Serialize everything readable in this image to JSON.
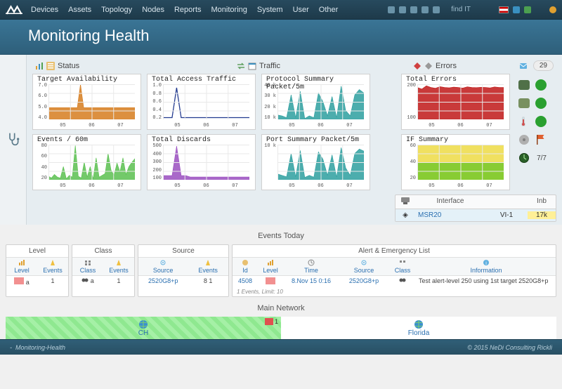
{
  "nav": {
    "links": [
      "Devices",
      "Assets",
      "Topology",
      "Nodes",
      "Reports",
      "Monitoring",
      "System",
      "User",
      "Other"
    ],
    "search": "find IT"
  },
  "title": "Monitoring Health",
  "sections": {
    "status": "Status",
    "traffic": "Traffic",
    "errors": "Errors",
    "errors_badge": "29"
  },
  "charts": {
    "c1": {
      "title": "Target Availability",
      "y": [
        "7.0",
        "6.0",
        "5.0",
        "4.0"
      ],
      "x": [
        "05",
        "06",
        "07"
      ]
    },
    "c2": {
      "title": "Events / 60m",
      "y": [
        "80",
        "60",
        "40",
        "20"
      ],
      "x": [
        "05",
        "06",
        "07"
      ]
    },
    "c3": {
      "title": "Total Access Traffic",
      "y": [
        "1.0",
        "0.8",
        "0.6",
        "0.4",
        "0.2"
      ],
      "x": [
        "05",
        "06",
        "07"
      ]
    },
    "c4": {
      "title": "Total Discards",
      "y": [
        "500",
        "400",
        "300",
        "200",
        "100"
      ],
      "x": [
        "05",
        "06",
        "07"
      ]
    },
    "c5": {
      "title": "Protocol Summary Packet/5m",
      "y": [
        "40 k",
        "30 k",
        "20 k",
        "10 k"
      ],
      "x": [
        "05",
        "06",
        "07"
      ]
    },
    "c6": {
      "title": "Port Summary  Packet/5m",
      "y": [
        "10 k"
      ],
      "x": [
        "05",
        "06",
        "07"
      ]
    },
    "c7": {
      "title": "Total Errors",
      "y": [
        "200",
        "100"
      ],
      "x": [
        "05",
        "06",
        "07"
      ]
    },
    "c8": {
      "title": "IF Summary",
      "y": [
        "60",
        "40",
        "20"
      ],
      "x": [
        "05",
        "06",
        "07"
      ]
    }
  },
  "right_badge": "7/7",
  "iftable": {
    "h1": "Interface",
    "h2": "",
    "h3": "Inb",
    "dev": "MSR20",
    "if": "VI-1",
    "inb": "17k"
  },
  "events_today": {
    "title": "Events Today",
    "level": {
      "title": "Level",
      "th": [
        "Level",
        "Events"
      ],
      "row": [
        "a",
        "1"
      ],
      "val": "1"
    },
    "class": {
      "title": "Class",
      "th": [
        "Class",
        "Events"
      ],
      "row": [
        "a",
        "1"
      ],
      "val": "1"
    },
    "source": {
      "title": "Source",
      "th": [
        "Source",
        "Events"
      ],
      "row": [
        "2520G8+p",
        "8  1"
      ]
    },
    "alert": {
      "title": "Alert & Emergency List",
      "th": [
        "Id",
        "Level",
        "Time",
        "Source",
        "Class",
        "Information"
      ],
      "row": [
        "4508",
        "",
        "8.Nov 15 0:16",
        "2520G8+p",
        "",
        "Test alert-level 250 using 1st target 2520G8+p"
      ],
      "foot": "1 Events, Limit: 10"
    }
  },
  "mainnet": {
    "title": "Main Network",
    "n1": "CH",
    "n2": "Florida",
    "flag": "1"
  },
  "footer": {
    "left": "Monitoring-Health",
    "right": "© 2015 NeDi Consulting Rickli"
  },
  "chart_data": [
    {
      "type": "area",
      "title": "Target Availability",
      "y": [
        5,
        5,
        5,
        5,
        5,
        5,
        5,
        5,
        5,
        5,
        7,
        5,
        5,
        5,
        5,
        5,
        5,
        5,
        5,
        5,
        5,
        5,
        5,
        5,
        5,
        5,
        5,
        5
      ],
      "ylim": [
        4,
        7
      ],
      "x_ticks": [
        "05",
        "06",
        "07"
      ],
      "series_color": "#d67c1f"
    },
    {
      "type": "area",
      "title": "Events / 60m",
      "y": [
        8,
        4,
        12,
        6,
        4,
        30,
        2,
        10,
        6,
        78,
        8,
        4,
        40,
        6,
        30,
        2,
        50,
        6,
        10,
        14,
        60,
        22,
        10,
        38,
        18,
        50,
        12,
        30,
        40,
        48
      ],
      "ylim": [
        0,
        80
      ],
      "x_ticks": [
        "05",
        "06",
        "07"
      ],
      "series_color": "#5ac050"
    },
    {
      "type": "line",
      "title": "Total Access Traffic",
      "y": [
        0.05,
        0.05,
        0.05,
        0.9,
        0.05,
        0.05,
        0.05,
        0.05,
        0.05,
        0.05,
        0.05,
        0.05,
        0.05,
        0.05,
        0.05,
        0.05,
        0.05,
        0.05,
        0.05,
        0.05
      ],
      "ylim": [
        0,
        1.0
      ],
      "x_ticks": [
        "05",
        "06",
        "07"
      ],
      "series_color": "#223a8f"
    },
    {
      "type": "area",
      "title": "Total Discards",
      "y": [
        60,
        60,
        60,
        480,
        60,
        60,
        40,
        40,
        40,
        40,
        40,
        40,
        40,
        40,
        40,
        40,
        40,
        40,
        40,
        40
      ],
      "ylim": [
        0,
        500
      ],
      "x_ticks": [
        "05",
        "06",
        "07"
      ],
      "series_color": "#9a4fc0"
    },
    {
      "type": "area",
      "title": "Protocol Summary Packet/5m",
      "y": [
        5000,
        4000,
        2000,
        28000,
        2000,
        32000,
        1000,
        4000,
        2000,
        30000,
        20000,
        4000,
        26000,
        2000,
        38000,
        10000,
        4000,
        28000,
        34000,
        30000
      ],
      "ylim": [
        0,
        40000
      ],
      "x_ticks": [
        "05",
        "06",
        "07"
      ],
      "series_color": "#2d9f9f"
    },
    {
      "type": "area",
      "title": "Port Summary Packet/5m",
      "y": [
        2000,
        1500,
        1000,
        9000,
        1000,
        10000,
        800,
        1500,
        900,
        9500,
        7000,
        1500,
        8500,
        900,
        11000,
        4000,
        1500,
        9000,
        10500,
        9800
      ],
      "ylim": [
        0,
        12000
      ],
      "x_ticks": [
        "05",
        "06",
        "07"
      ],
      "series_color": "#2d9f9f"
    },
    {
      "type": "area",
      "title": "Total Errors",
      "y": [
        200,
        190,
        210,
        200,
        195,
        205,
        200,
        198,
        202,
        200,
        196,
        204,
        200,
        199,
        201,
        200,
        197,
        203,
        200,
        200
      ],
      "ylim": [
        0,
        220
      ],
      "x_ticks": [
        "05",
        "06",
        "07"
      ],
      "series_color": "#c01818"
    },
    {
      "type": "stacked-area",
      "title": "IF Summary",
      "categories_x": [
        "05",
        "06",
        "07"
      ],
      "series": [
        {
          "name": "green",
          "color": "#88cc33",
          "y": [
            30,
            30,
            30,
            30,
            30,
            30,
            30,
            30,
            30,
            30,
            30,
            30,
            30,
            30,
            30,
            30,
            30,
            30,
            30,
            30
          ]
        },
        {
          "name": "yellow",
          "color": "#f0e060",
          "y": [
            30,
            30,
            30,
            30,
            30,
            30,
            30,
            30,
            30,
            30,
            30,
            30,
            30,
            30,
            30,
            30,
            30,
            30,
            30,
            30
          ]
        }
      ],
      "ylim": [
        0,
        60
      ]
    }
  ]
}
